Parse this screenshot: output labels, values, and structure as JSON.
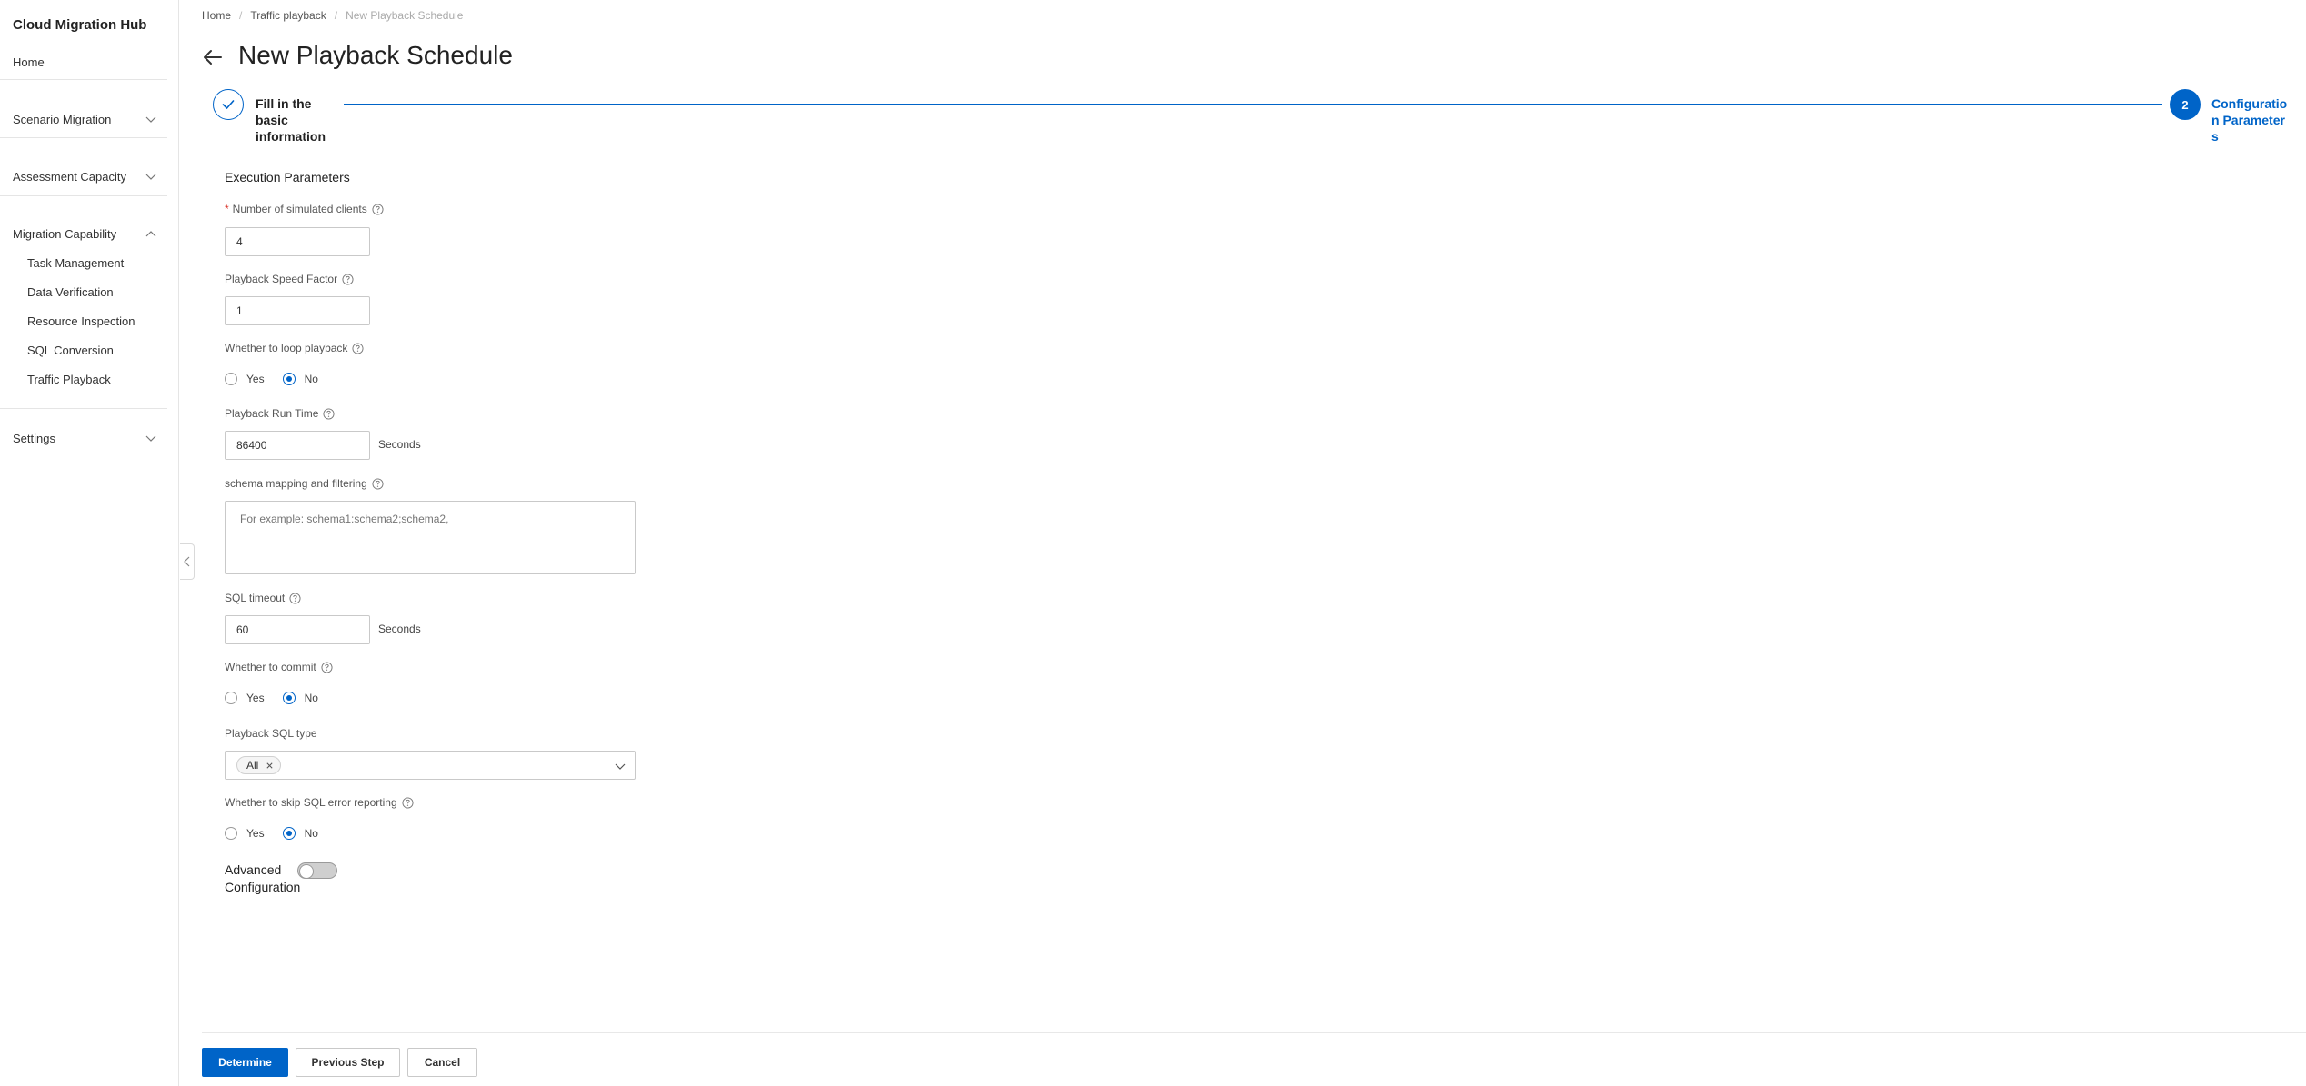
{
  "app": {
    "title": "Cloud Migration Hub"
  },
  "sidebar": {
    "home": "Home",
    "groups": [
      {
        "label": "Scenario Migration",
        "expanded": false
      },
      {
        "label": "Assessment Capacity",
        "expanded": false
      },
      {
        "label": "Migration Capability",
        "expanded": true,
        "items": [
          "Task Management",
          "Data Verification",
          "Resource Inspection",
          "SQL Conversion",
          "Traffic Playback"
        ]
      },
      {
        "label": "Settings",
        "expanded": false
      }
    ]
  },
  "breadcrumb": [
    "Home",
    "Traffic playback",
    "New Playback Schedule"
  ],
  "page": {
    "title": "New Playback Schedule"
  },
  "steps": [
    {
      "label": "Fill in the basic information",
      "status": "done"
    },
    {
      "number": "2",
      "label": "Configuration Parameters",
      "status": "active"
    }
  ],
  "form": {
    "section_title": "Execution Parameters",
    "clients": {
      "required_mark": "*",
      "label": "Number of simulated clients",
      "value": "4"
    },
    "speed": {
      "label": "Playback Speed Factor",
      "value": "1"
    },
    "loop": {
      "label": "Whether to loop playback",
      "options": [
        "Yes",
        "No"
      ],
      "selected": "No"
    },
    "run_time": {
      "label": "Playback Run Time",
      "value": "86400",
      "unit": "Seconds"
    },
    "schema": {
      "label": "schema mapping and filtering",
      "placeholder": "For example: schema1:schema2;schema2,"
    },
    "sql_timeout": {
      "label": "SQL timeout",
      "value": "60",
      "unit": "Seconds"
    },
    "commit": {
      "label": "Whether to commit",
      "options": [
        "Yes",
        "No"
      ],
      "selected": "No"
    },
    "sql_type": {
      "label": "Playback SQL type",
      "selected_tags": [
        "All"
      ]
    },
    "skip_error": {
      "label": "Whether to skip SQL error reporting",
      "options": [
        "Yes",
        "No"
      ],
      "selected": "No"
    },
    "advanced": {
      "label": "Advanced Configuration",
      "enabled": false
    }
  },
  "footer": {
    "determine": "Determine",
    "previous": "Previous Step",
    "cancel": "Cancel"
  },
  "colors": {
    "primary": "#0064c8",
    "required": "#d93026",
    "border": "#c9c9c9"
  }
}
